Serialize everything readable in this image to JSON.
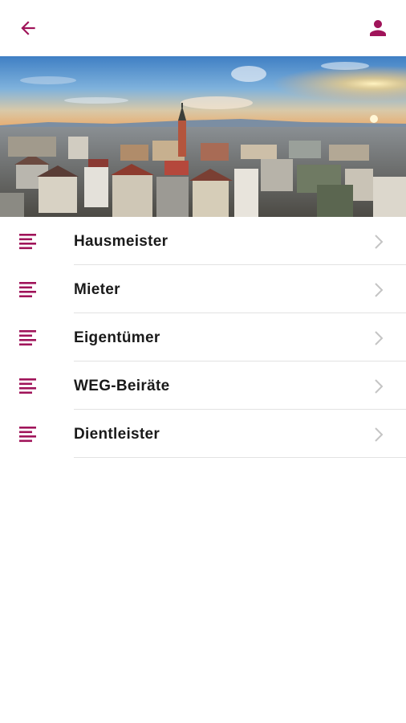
{
  "header": {
    "back_icon": "arrow-left-icon",
    "profile_icon": "person-icon",
    "accent_color": "#a0145a"
  },
  "hero": {
    "image": "city-panorama-at-sunset"
  },
  "menu": {
    "item_icon": "list-lines-icon",
    "chevron_icon": "chevron-right-icon",
    "items": [
      {
        "label": "Hausmeister"
      },
      {
        "label": "Mieter"
      },
      {
        "label": "Eigentümer"
      },
      {
        "label": "WEG-Beiräte"
      },
      {
        "label": "Dientleister"
      }
    ]
  }
}
